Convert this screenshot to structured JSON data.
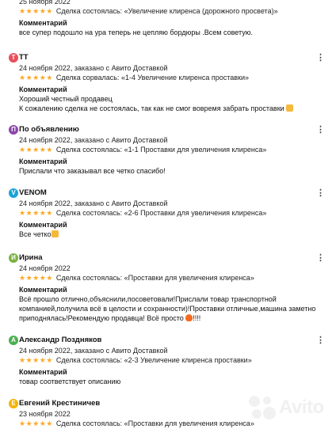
{
  "reviews": [
    {
      "date": "25 ноября 2022",
      "deal": "Сделка состоялась: «Увеличение клиренса (дорожного просвета)»",
      "comment_label": "Комментарий",
      "comment": "все супер подошло на ура теперь не цепляю бордюры .Всем советую."
    },
    {
      "initial": "T",
      "avatar_color": "#e8505b",
      "author": "TT",
      "date": "24 ноября 2022, заказано с Авито Доставкой",
      "deal": "Сделка сорвалась: «1-4 Увеличение клиренса проставки»",
      "comment_label": "Комментарий",
      "comment_lines": [
        "Хороший честный продавец",
        "К сожалению сделка не состоялась, так как не смог вовремя забрать проставки"
      ],
      "emoji": "thumbs-up"
    },
    {
      "initial": "П",
      "avatar_color": "#8e44ad",
      "author": "По объявлению",
      "date": "24 ноября 2022, заказано с Авито Доставкой",
      "deal": "Сделка состоялась: «1-1 Проставки для увеличения клиренса»",
      "comment_label": "Комментарий",
      "comment": "Прислали что заказывал все четко спасибо!"
    },
    {
      "initial": "V",
      "avatar_color": "#1aa3d9",
      "author": "VENOM",
      "date": "24 ноября 2022, заказано с Авито Доставкой",
      "deal": "Сделка состоялась: «2-6 Проставки для увеличения клиренса»",
      "comment_label": "Комментарий",
      "comment": "Все четко",
      "emoji": "thumbs-up"
    },
    {
      "initial": "И",
      "avatar_color": "#7cb342",
      "author": "Ирина",
      "date": "24 ноября 2022",
      "deal": "Сделка состоялась: «Проставки для увеличения клиренса»",
      "comment_label": "Комментарий",
      "comment_lines": [
        "Всё прошло отлично,объяснили,посоветовали!Прислали товар транспортной",
        "компанией,получила всё в целости и сохранности)!Проставки отличные,машина заметно",
        "приподнялась!Рекомендую продавца! Всё просто"
      ],
      "comment_tail": "!!!!",
      "emoji": "fire"
    },
    {
      "initial": "А",
      "avatar_color": "#4caf50",
      "author": "Александр Поздняков",
      "date": "24 ноября 2022, заказано с Авито Доставкой",
      "deal": "Сделка состоялась: «2-3 Увеличение клиренса проставки»",
      "comment_label": "Комментарий",
      "comment": "товар соответствует описанию"
    },
    {
      "initial": "Е",
      "avatar_color": "#f4b400",
      "author": "Евгений Крестиничев",
      "date": "23 ноября 2022",
      "deal": "Сделка состоялась: «Проставки для увеличения клиренса»"
    }
  ],
  "stars": "★★★★★",
  "menu_glyph": "⋮",
  "watermark_text": "Avito"
}
